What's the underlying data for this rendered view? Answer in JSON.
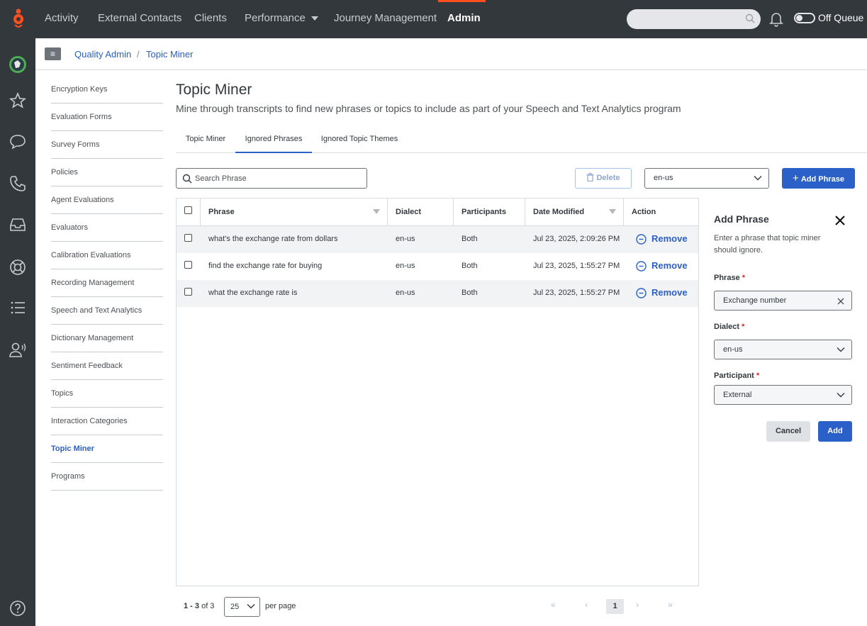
{
  "topnav": {
    "items": [
      {
        "label": "Activity"
      },
      {
        "label": "External Contacts"
      },
      {
        "label": "Clients"
      },
      {
        "label": "Performance"
      },
      {
        "label": "Journey Management"
      },
      {
        "label": "Admin"
      }
    ],
    "active": "Admin",
    "accent_color": "#ff4f1f",
    "queue_label": "Off Queue"
  },
  "rail": {
    "icons": [
      "avatar-globe-icon",
      "star-icon",
      "chat-icon",
      "phone-icon",
      "inbox-icon",
      "lifebuoy-icon",
      "list-icon",
      "person-voice-icon",
      "help-icon"
    ]
  },
  "breadcrumb": {
    "parent": "Quality Admin",
    "separator": "/",
    "current": "Topic Miner"
  },
  "subnav": {
    "items": [
      {
        "label": "Encryption Keys"
      },
      {
        "label": "Evaluation Forms"
      },
      {
        "label": "Survey Forms"
      },
      {
        "label": "Policies"
      },
      {
        "label": "Agent Evaluations"
      },
      {
        "label": "Evaluators"
      },
      {
        "label": "Calibration Evaluations"
      },
      {
        "label": "Recording Management"
      },
      {
        "label": "Speech and Text Analytics"
      },
      {
        "label": "Dictionary Management"
      },
      {
        "label": "Sentiment Feedback"
      },
      {
        "label": "Topics"
      },
      {
        "label": "Interaction Categories"
      },
      {
        "label": "Topic Miner"
      },
      {
        "label": "Programs"
      }
    ],
    "active": "Topic Miner"
  },
  "page": {
    "title": "Topic Miner",
    "subtitle": "Mine through transcripts to find new phrases or topics to include as part of your Speech and Text Analytics program"
  },
  "tabs": [
    {
      "label": "Topic Miner"
    },
    {
      "label": "Ignored Phrases"
    },
    {
      "label": "Ignored Topic Themes"
    }
  ],
  "active_tab": "Ignored Phrases",
  "toolbar": {
    "search_placeholder": "Search Phrase",
    "delete_label": "Delete",
    "dialect_value": "en-us",
    "add_phrase_label": "Add Phrase"
  },
  "table": {
    "headers": {
      "phrase": "Phrase",
      "dialect": "Dialect",
      "participants": "Participants",
      "date_modified": "Date Modified",
      "action": "Action"
    },
    "rows": [
      {
        "phrase": "what's the exchange rate from dollars",
        "dialect": "en-us",
        "participants": "Both",
        "date_modified": "Jul 23, 2025, 2:09:26 PM",
        "action": "Remove"
      },
      {
        "phrase": "find the exchange rate for buying",
        "dialect": "en-us",
        "participants": "Both",
        "date_modified": "Jul 23, 2025, 1:55:27 PM",
        "action": "Remove"
      },
      {
        "phrase": "what the exchange rate is",
        "dialect": "en-us",
        "participants": "Both",
        "date_modified": "Jul 23, 2025, 1:55:27 PM",
        "action": "Remove"
      }
    ]
  },
  "pagination": {
    "range": "1 - 3",
    "of_label": "of 3",
    "per_page_value": "25",
    "per_page_label": "per page",
    "first": "«",
    "prev": "‹",
    "current_page": "1",
    "next": "›",
    "last": "»"
  },
  "panel": {
    "title": "Add Phrase",
    "description": "Enter a phrase that topic miner should ignore.",
    "phrase_label": "Phrase",
    "phrase_value": "Exchange number",
    "dialect_label": "Dialect",
    "dialect_value": "en-us",
    "participant_label": "Participant",
    "participant_value": "External",
    "required_mark": "*",
    "cancel_label": "Cancel",
    "add_label": "Add"
  },
  "colors": {
    "primary": "#2a60c8",
    "nav_bg": "#33383d",
    "required": "#d9261c"
  }
}
